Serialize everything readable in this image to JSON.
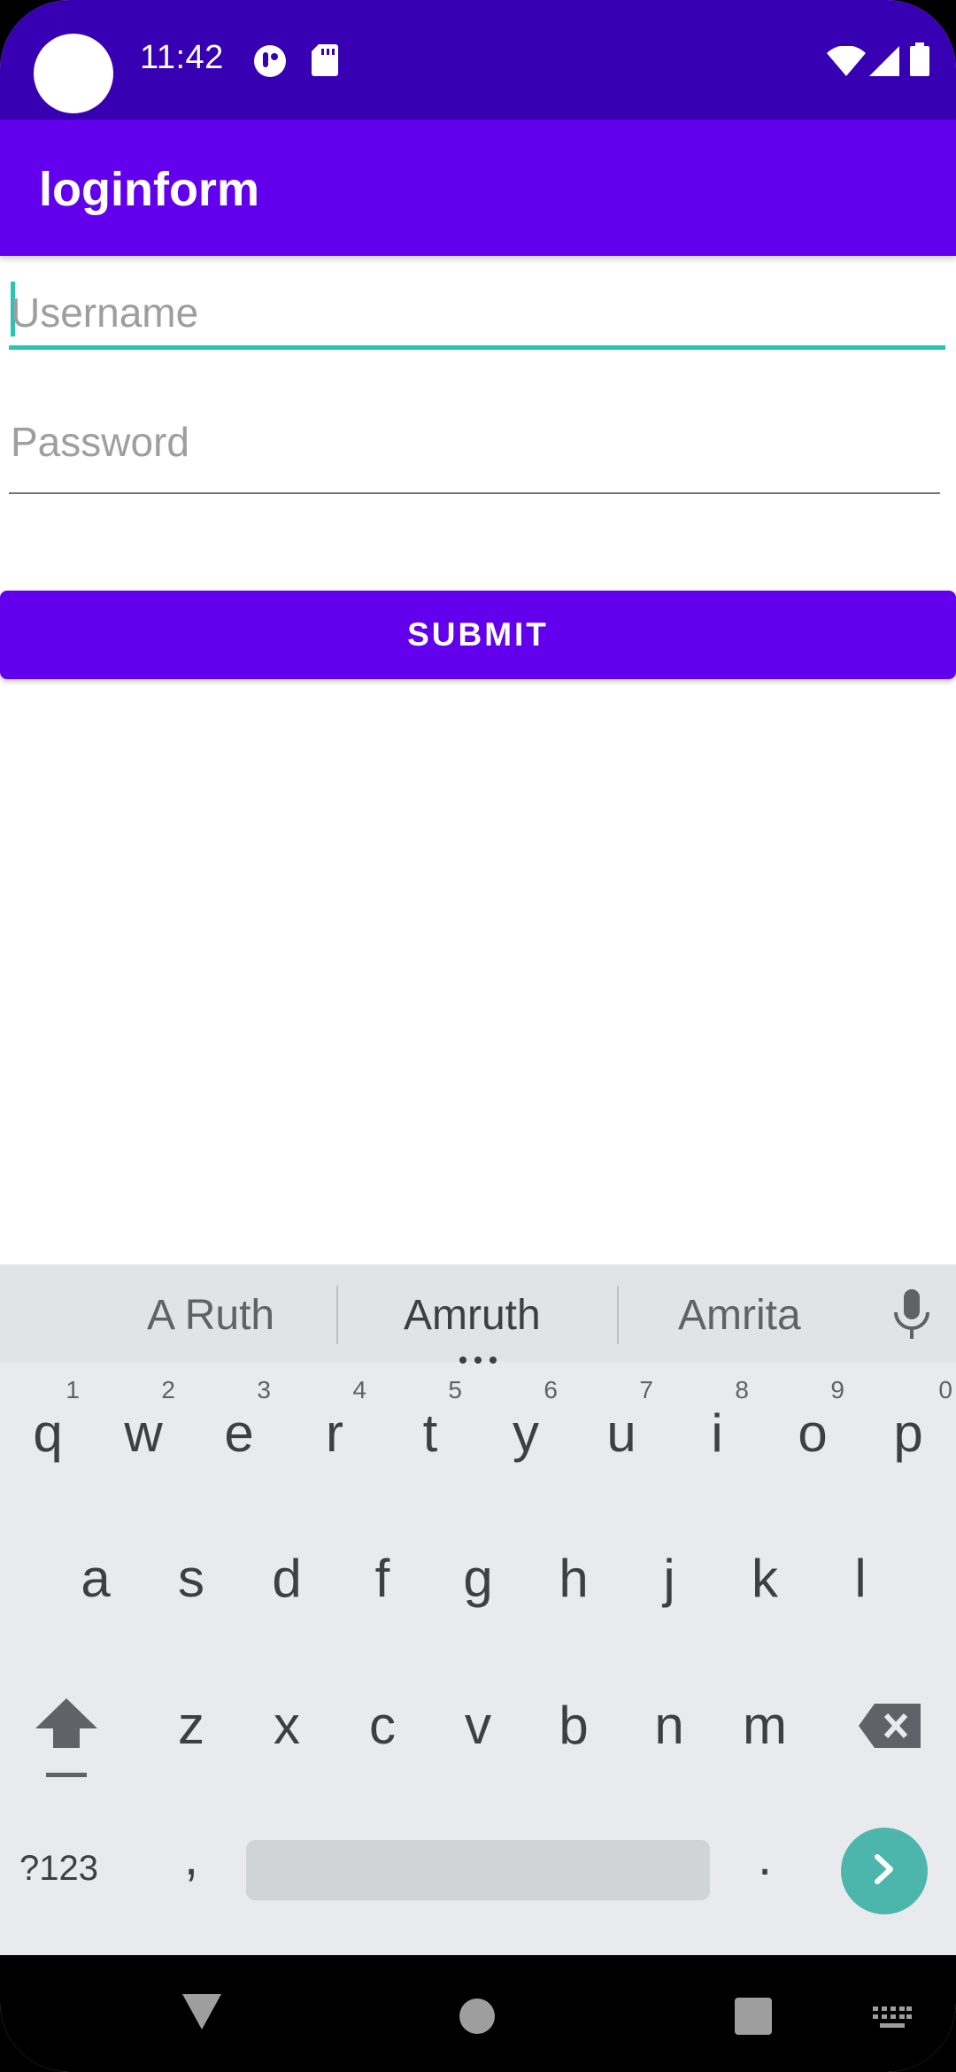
{
  "status_bar": {
    "time": "11:42",
    "icons": [
      "profile-icon",
      "sd-card-icon",
      "wifi-icon",
      "signal-icon",
      "battery-icon"
    ],
    "background": "#3700b3"
  },
  "app_bar": {
    "title": "loginform",
    "background": "#6200ee"
  },
  "form": {
    "username_placeholder": "Username",
    "password_placeholder": "Password",
    "submit_label": "SUBMIT",
    "focused_field": "username",
    "accent_color": "#26c6b6"
  },
  "keyboard": {
    "suggestions": [
      "A Ruth",
      "Amruth",
      "Amrita"
    ],
    "row1": [
      {
        "ch": "q",
        "num": "1"
      },
      {
        "ch": "w",
        "num": "2"
      },
      {
        "ch": "e",
        "num": "3"
      },
      {
        "ch": "r",
        "num": "4"
      },
      {
        "ch": "t",
        "num": "5"
      },
      {
        "ch": "y",
        "num": "6"
      },
      {
        "ch": "u",
        "num": "7"
      },
      {
        "ch": "i",
        "num": "8"
      },
      {
        "ch": "o",
        "num": "9"
      },
      {
        "ch": "p",
        "num": "0"
      }
    ],
    "row2": [
      "a",
      "s",
      "d",
      "f",
      "g",
      "h",
      "j",
      "k",
      "l"
    ],
    "row3": [
      "z",
      "x",
      "c",
      "v",
      "b",
      "n",
      "m"
    ],
    "symbols_label": "?123",
    "comma": ",",
    "period": ".",
    "go_color": "#4db6ac"
  },
  "nav_bar": {
    "icons": [
      "back-icon",
      "home-icon",
      "recents-icon",
      "keyboard-switch-icon"
    ]
  }
}
